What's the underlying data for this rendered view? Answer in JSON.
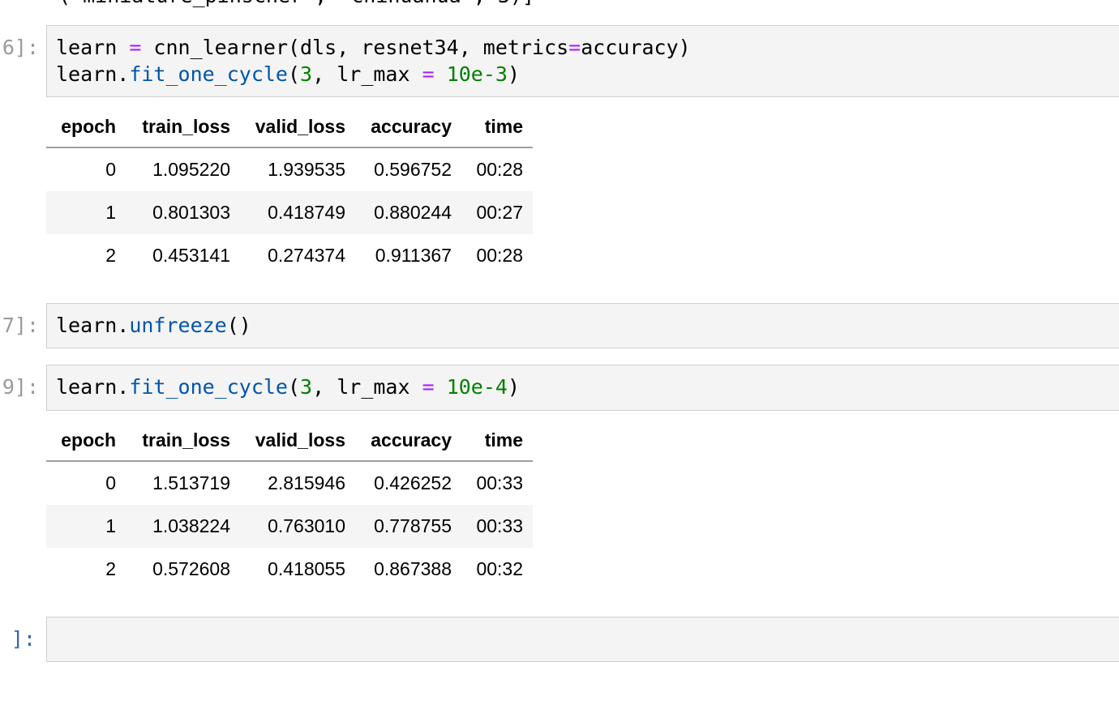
{
  "top_partial_line": "('miniature_pinscher', 'chihuahua', 3)]",
  "cells": [
    {
      "prompt": "6]:",
      "lines": [
        [
          {
            "t": "learn ",
            "k": "plain"
          },
          {
            "t": "=",
            "k": "op"
          },
          {
            "t": " cnn_learner(dls, resnet34, metrics",
            "k": "plain"
          },
          {
            "t": "=",
            "k": "op"
          },
          {
            "t": "accuracy)",
            "k": "plain"
          }
        ],
        [
          {
            "t": "learn.",
            "k": "plain"
          },
          {
            "t": "fit_one_cycle",
            "k": "fn"
          },
          {
            "t": "(",
            "k": "plain"
          },
          {
            "t": "3",
            "k": "num"
          },
          {
            "t": ", lr_max ",
            "k": "plain"
          },
          {
            "t": "=",
            "k": "op"
          },
          {
            "t": " ",
            "k": "plain"
          },
          {
            "t": "10e-3",
            "k": "num"
          },
          {
            "t": ")",
            "k": "plain"
          }
        ]
      ],
      "table": {
        "headers": [
          "epoch",
          "train_loss",
          "valid_loss",
          "accuracy",
          "time"
        ],
        "rows": [
          [
            "0",
            "1.095220",
            "1.939535",
            "0.596752",
            "00:28"
          ],
          [
            "1",
            "0.801303",
            "0.418749",
            "0.880244",
            "00:27"
          ],
          [
            "2",
            "0.453141",
            "0.274374",
            "0.911367",
            "00:28"
          ]
        ]
      }
    },
    {
      "prompt": "7]:",
      "lines": [
        [
          {
            "t": "learn.",
            "k": "plain"
          },
          {
            "t": "unfreeze",
            "k": "fn"
          },
          {
            "t": "()",
            "k": "plain"
          }
        ]
      ]
    },
    {
      "prompt": "9]:",
      "lines": [
        [
          {
            "t": "learn.",
            "k": "plain"
          },
          {
            "t": "fit_one_cycle",
            "k": "fn"
          },
          {
            "t": "(",
            "k": "plain"
          },
          {
            "t": "3",
            "k": "num"
          },
          {
            "t": ", lr_max ",
            "k": "plain"
          },
          {
            "t": "=",
            "k": "op"
          },
          {
            "t": " ",
            "k": "plain"
          },
          {
            "t": "10e-4",
            "k": "num"
          },
          {
            "t": ")",
            "k": "plain"
          }
        ]
      ],
      "table": {
        "headers": [
          "epoch",
          "train_loss",
          "valid_loss",
          "accuracy",
          "time"
        ],
        "rows": [
          [
            "0",
            "1.513719",
            "2.815946",
            "0.426252",
            "00:33"
          ],
          [
            "1",
            "1.038224",
            "0.763010",
            "0.778755",
            "00:33"
          ],
          [
            "2",
            "0.572608",
            "0.418055",
            "0.867388",
            "00:32"
          ]
        ]
      }
    },
    {
      "prompt": "]:",
      "lines": []
    }
  ],
  "colors": {
    "operator": "#aa22ff",
    "function": "#0055aa",
    "number": "#008000",
    "prompt_executed": "#9a9a9a",
    "prompt_empty": "#2f68ad",
    "code_background": "#f4f4f4"
  }
}
